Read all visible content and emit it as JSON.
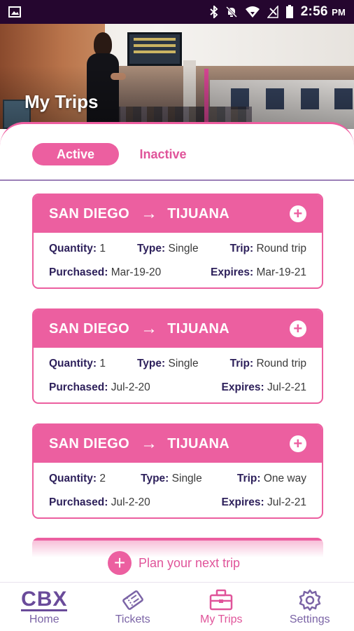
{
  "status_bar": {
    "time": "2:56",
    "ampm": "PM",
    "icons": [
      "image-icon",
      "bluetooth-icon",
      "mute-icon",
      "wifi-icon",
      "no-signal-icon",
      "battery-icon"
    ]
  },
  "header": {
    "title": "My Trips"
  },
  "tabs": {
    "active_label": "Active",
    "inactive_label": "Inactive"
  },
  "trips": [
    {
      "origin": "SAN DIEGO",
      "destination": "TIJUANA",
      "quantity_label": "Quantity:",
      "quantity": "1",
      "type_label": "Type:",
      "type": "Single",
      "trip_label": "Trip:",
      "trip": "Round trip",
      "purchased_label": "Purchased:",
      "purchased": "Mar-19-20",
      "expires_label": "Expires:",
      "expires": "Mar-19-21"
    },
    {
      "origin": "SAN DIEGO",
      "destination": "TIJUANA",
      "quantity_label": "Quantity:",
      "quantity": "1",
      "type_label": "Type:",
      "type": "Single",
      "trip_label": "Trip:",
      "trip": "Round trip",
      "purchased_label": "Purchased:",
      "purchased": "Jul-2-20",
      "expires_label": "Expires:",
      "expires": "Jul-2-21"
    },
    {
      "origin": "SAN DIEGO",
      "destination": "TIJUANA",
      "quantity_label": "Quantity:",
      "quantity": "2",
      "type_label": "Type:",
      "type": "Single",
      "trip_label": "Trip:",
      "trip": "One way",
      "purchased_label": "Purchased:",
      "purchased": "Jul-2-20",
      "expires_label": "Expires:",
      "expires": "Jul-2-21"
    }
  ],
  "plan_trip": {
    "label": "Plan your next trip"
  },
  "bottom_nav": {
    "logo_text": "CBX",
    "home": "Home",
    "tickets": "Tickets",
    "my_trips": "My Trips",
    "settings": "Settings"
  },
  "colors": {
    "accent_pink": "#ec5fa0",
    "purple": "#7b64a6",
    "status_bar": "#25062f"
  }
}
